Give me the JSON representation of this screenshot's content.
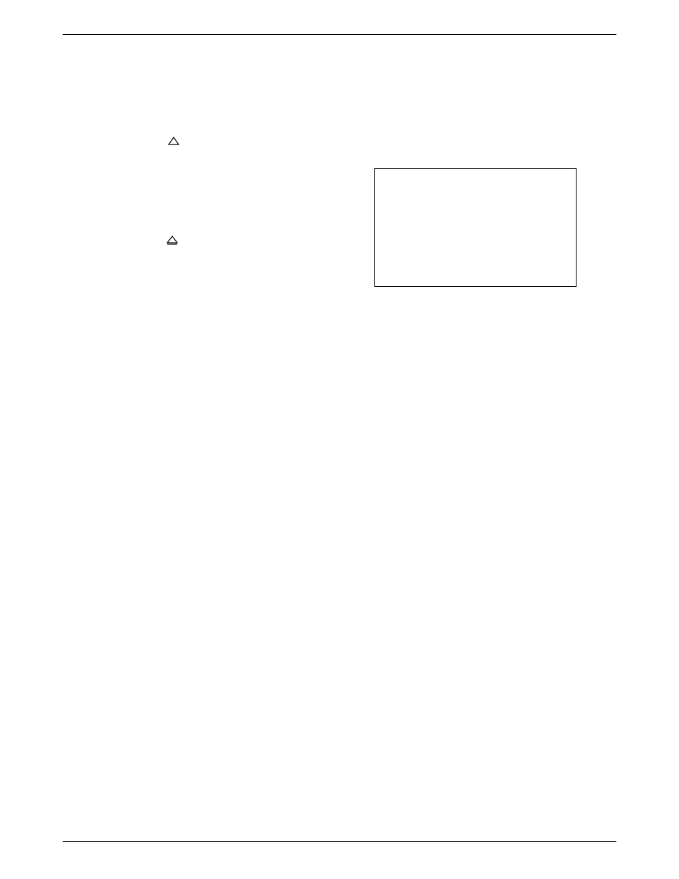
{
  "lines": [
    {
      "indent": 76,
      "kind": "tri",
      "text": ""
    },
    {
      "indent": 114,
      "kind": "tri2",
      "text": ""
    }
  ]
}
